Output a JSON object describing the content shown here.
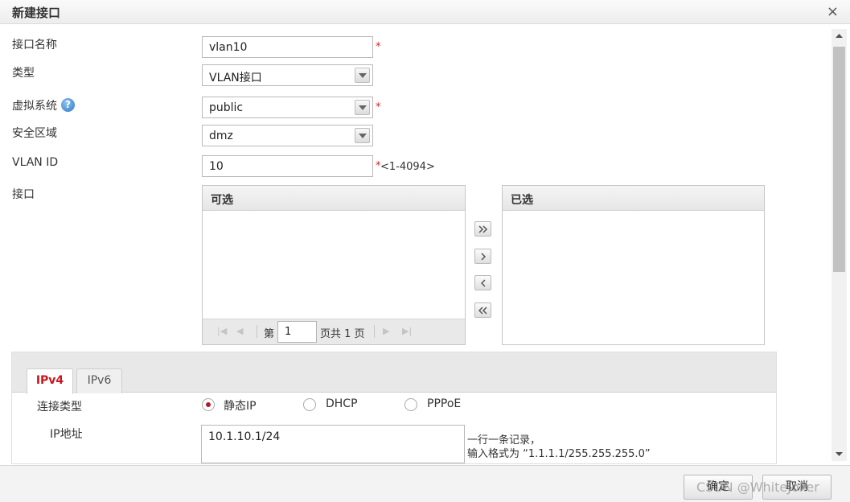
{
  "dialog": {
    "title": "新建接口",
    "close_glyph": "×"
  },
  "form": {
    "name": {
      "label": "接口名称",
      "value": "vlan10",
      "required": "*"
    },
    "type": {
      "label": "类型",
      "value": "VLAN接口"
    },
    "vsys": {
      "label": "虚拟系统",
      "help": "?",
      "value": "public",
      "required": "*"
    },
    "zone": {
      "label": "安全区域",
      "value": "dmz"
    },
    "vlan_id": {
      "label": "VLAN ID",
      "value": "10",
      "required": "*",
      "hint": "<1-4094>"
    },
    "interfaces": {
      "label": "接口",
      "available_header": "可选",
      "selected_header": "已选",
      "pager": {
        "prefix": "第",
        "page": "1",
        "suffix": "页共 1 页"
      }
    }
  },
  "net": {
    "tabs": [
      "IPv4",
      "IPv6"
    ],
    "active_tab": "IPv4",
    "conn_type": {
      "label": "连接类型",
      "options": [
        "静态IP",
        "DHCP",
        "PPPoE"
      ],
      "selected": "静态IP"
    },
    "ip": {
      "label": "IP地址",
      "value": "10.1.10.1/24",
      "hint_line1": "一行一条记录，",
      "hint_line2": "输入格式为 “1.1.1.1/255.255.255.0”"
    }
  },
  "footer": {
    "ok_label": "确定",
    "cancel_label": "取消",
    "watermark": "CSDN @WhiteJoker"
  },
  "colors": {
    "required": "#dd2222",
    "active_tab": "#c8161d",
    "radio_dot": "#b01d2a"
  }
}
